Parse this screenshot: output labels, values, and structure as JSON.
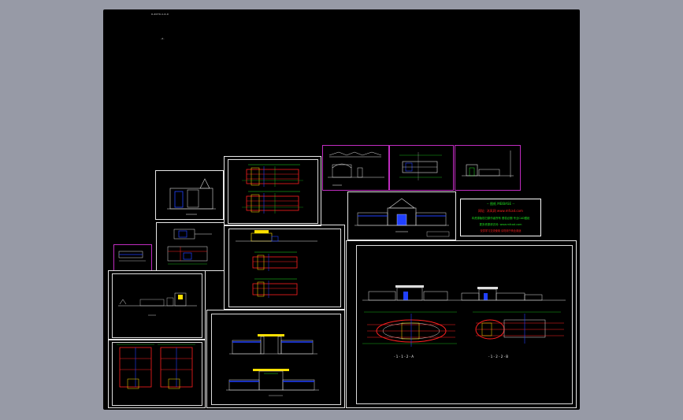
{
  "drawing": {
    "corner_note": "0-2070-1-0-0",
    "note_small": "-2-",
    "captions": {
      "elev_a": "- 1 - 1 - 2 - A",
      "elev_b": "- 1 - 2 - 2 - B"
    }
  },
  "title_block": {
    "line1": "-- 图纸  MEIBASE --",
    "line2": "网址: 沐风网 www.mfcad.com",
    "line3": "本资源版权归原作者所有  侵权必删  专业CAD图纸",
    "line4": "更多资源请访问: www.mfcad.com",
    "line5": "仅供学习交流使用  请勿用于商业用途"
  },
  "colors": {
    "background": "#979aa6",
    "canvas": "#000000",
    "red": "#ff2020",
    "green": "#20e020",
    "yellow": "#ffe000",
    "blue": "#2040ff",
    "cyan": "#20e0e0",
    "magenta": "#c02cc0",
    "white": "#ffffff"
  }
}
